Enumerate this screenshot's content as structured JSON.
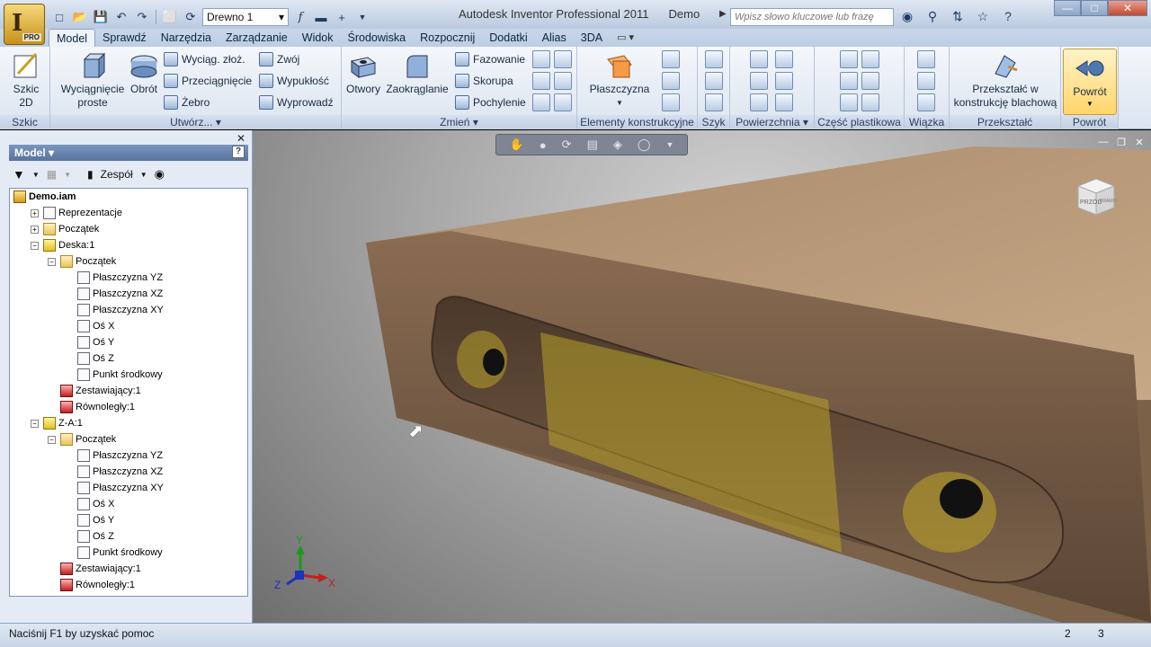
{
  "app": {
    "title": "Autodesk Inventor Professional 2011",
    "document": "Demo",
    "logo": "I",
    "edition": "PRO"
  },
  "qat": {
    "material": "Drewno 1",
    "icons": [
      "new-icon",
      "open-icon",
      "save-icon",
      "undo-icon",
      "redo-icon",
      "select-icon",
      "update-icon",
      "color-icon",
      "fx-icon",
      "measure-icon"
    ]
  },
  "help": {
    "search_placeholder": "Wpisz słowo kluczowe lub frazę"
  },
  "tabs": [
    "Model",
    "Sprawdź",
    "Narzędzia",
    "Zarządzanie",
    "Widok",
    "Środowiska",
    "Rozpocznij",
    "Dodatki",
    "Alias",
    "3DA"
  ],
  "active_tab": "Model",
  "ribbon": {
    "szkic": {
      "title": "Szkic",
      "btn": "Szkic\n2D",
      "btn_l1": "Szkic",
      "btn_l2": "2D"
    },
    "utworz": {
      "title": "Utwórz...",
      "wyciagniecie_l1": "Wyciągnięcie",
      "wyciagniecie_l2": "proste",
      "obrot": "Obrót",
      "wyciag_zloz": "Wyciąg. złoż.",
      "przeciagniecie": "Przeciągnięcie",
      "zebro": "Żebro",
      "zwoj": "Zwój",
      "wypuklosc": "Wypukłość",
      "wyprowadz": "Wyprowadź"
    },
    "zmien": {
      "title": "Zmień",
      "otwory": "Otwory",
      "zaokraglanie": "Zaokrąglanie",
      "fazowanie": "Fazowanie",
      "skorupa": "Skorupa",
      "pochylenie": "Pochylenie"
    },
    "elementy": {
      "title": "Elementy konstrukcyjne",
      "plaszczyzna": "Płaszczyzna"
    },
    "szyk": {
      "title": "Szyk"
    },
    "powierzchnia": {
      "title": "Powierzchnia"
    },
    "plastik": {
      "title": "Część plastikowa"
    },
    "wiazka": {
      "title": "Wiązka"
    },
    "przeksztalc": {
      "title": "Przekształć",
      "btn_l1": "Przekształć w",
      "btn_l2": "konstrukcję blachową"
    },
    "powrot": {
      "title": "Powrót",
      "btn": "Powrót"
    }
  },
  "browser": {
    "title": "Model",
    "filter_label": "Zespół",
    "tree": [
      {
        "label": "Demo.iam",
        "level": 0,
        "icon": "asm",
        "root": true
      },
      {
        "label": "Reprezentacje",
        "level": 1,
        "icon": "axis",
        "expander": "+"
      },
      {
        "label": "Początek",
        "level": 1,
        "icon": "folder",
        "expander": "+"
      },
      {
        "label": "Deska:1",
        "level": 1,
        "icon": "part",
        "expander": "-"
      },
      {
        "label": "Początek",
        "level": 2,
        "icon": "folder",
        "expander": "-"
      },
      {
        "label": "Płaszczyzna YZ",
        "level": 3,
        "icon": "axis"
      },
      {
        "label": "Płaszczyzna XZ",
        "level": 3,
        "icon": "axis"
      },
      {
        "label": "Płaszczyzna XY",
        "level": 3,
        "icon": "axis"
      },
      {
        "label": "Oś X",
        "level": 3,
        "icon": "axis"
      },
      {
        "label": "Oś Y",
        "level": 3,
        "icon": "axis"
      },
      {
        "label": "Oś Z",
        "level": 3,
        "icon": "axis"
      },
      {
        "label": "Punkt środkowy",
        "level": 3,
        "icon": "axis"
      },
      {
        "label": "Zestawiający:1",
        "level": 2,
        "icon": "constraint"
      },
      {
        "label": "Równoległy:1",
        "level": 2,
        "icon": "constraint"
      },
      {
        "label": "Z-A:1",
        "level": 1,
        "icon": "part",
        "expander": "-"
      },
      {
        "label": "Początek",
        "level": 2,
        "icon": "folder",
        "expander": "-"
      },
      {
        "label": "Płaszczyzna YZ",
        "level": 3,
        "icon": "axis"
      },
      {
        "label": "Płaszczyzna XZ",
        "level": 3,
        "icon": "axis"
      },
      {
        "label": "Płaszczyzna XY",
        "level": 3,
        "icon": "axis"
      },
      {
        "label": "Oś X",
        "level": 3,
        "icon": "axis"
      },
      {
        "label": "Oś Y",
        "level": 3,
        "icon": "axis"
      },
      {
        "label": "Oś Z",
        "level": 3,
        "icon": "axis"
      },
      {
        "label": "Punkt środkowy",
        "level": 3,
        "icon": "axis"
      },
      {
        "label": "Zestawiający:1",
        "level": 2,
        "icon": "constraint"
      },
      {
        "label": "Równoległy:1",
        "level": 2,
        "icon": "constraint"
      }
    ]
  },
  "viewport": {
    "viewcube_label": "PRZÓD",
    "viewcube_side": "PRAWO",
    "axes": {
      "x": "X",
      "y": "Y",
      "z": "Z"
    }
  },
  "status": {
    "text": "Naciśnij F1 by uzyskać pomoc",
    "num1": "2",
    "num2": "3"
  }
}
